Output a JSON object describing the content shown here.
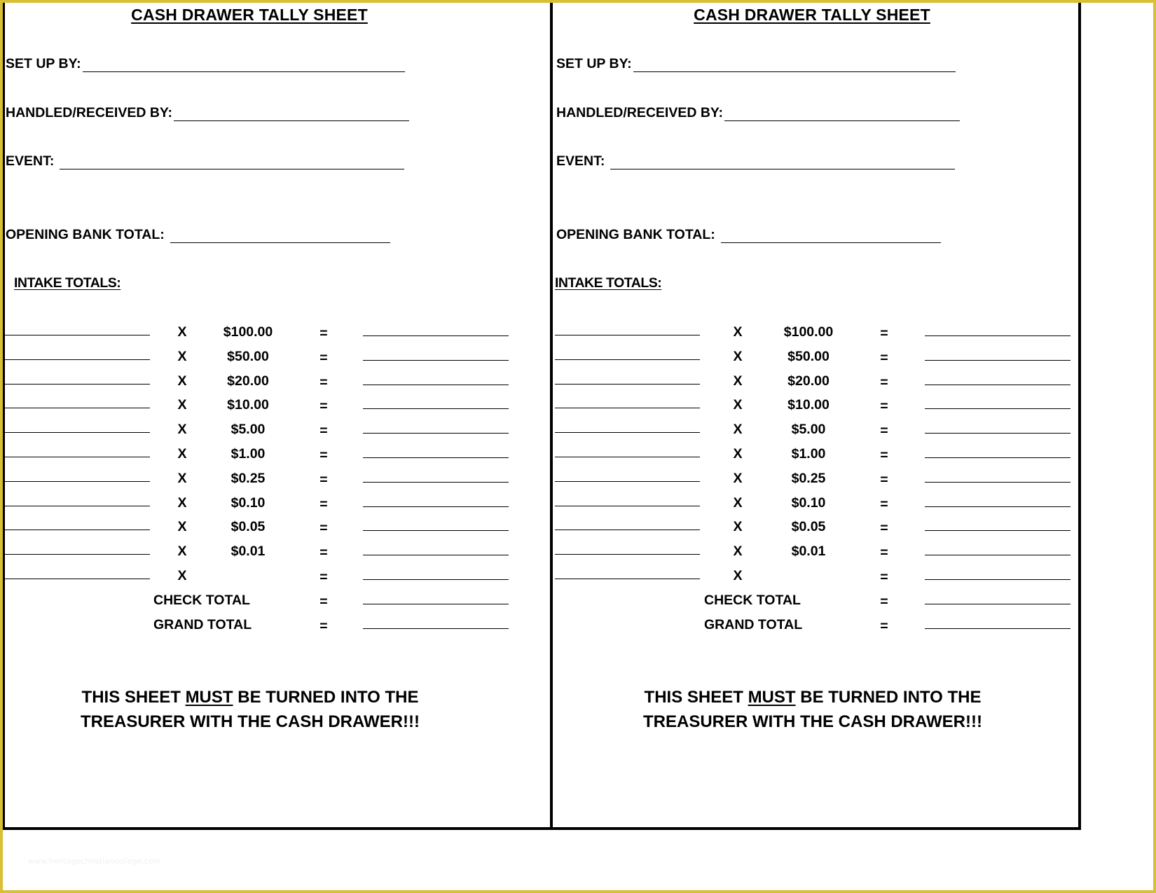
{
  "sheets": [
    {
      "title": "CASH DRAWER TALLY SHEET",
      "fields": {
        "set_up_by": "SET UP BY:",
        "handled_received_by": "HANDLED/RECEIVED BY:",
        "event": "EVENT:",
        "opening_bank_total": "OPENING BANK TOTAL:"
      },
      "intake_heading": "INTAKE TOTALS:",
      "multiply_symbol": "X",
      "equals_symbol": "=",
      "denominations": [
        "$100.00",
        "$50.00",
        "$20.00",
        "$10.00",
        "$5.00",
        "$1.00",
        "$0.25",
        "$0.10",
        "$0.05",
        "$0.01",
        ""
      ],
      "check_total_label": "CHECK TOTAL",
      "grand_total_label": "GRAND TOTAL",
      "notice": {
        "prefix": "THIS SHEET ",
        "emphasis": "MUST",
        "suffix": " BE TURNED INTO THE",
        "line2": "TREASURER WITH THE CASH DRAWER!!!"
      }
    },
    {
      "title": "CASH DRAWER TALLY SHEET",
      "fields": {
        "set_up_by": "SET UP BY:",
        "handled_received_by": "HANDLED/RECEIVED BY:",
        "event": "EVENT:",
        "opening_bank_total": "OPENING BANK TOTAL:"
      },
      "intake_heading": "INTAKE TOTALS:",
      "multiply_symbol": "X",
      "equals_symbol": "=",
      "denominations": [
        "$100.00",
        "$50.00",
        "$20.00",
        "$10.00",
        "$5.00",
        "$1.00",
        "$0.25",
        "$0.10",
        "$0.05",
        "$0.01",
        ""
      ],
      "check_total_label": "CHECK TOTAL",
      "grand_total_label": "GRAND TOTAL",
      "notice": {
        "prefix": "THIS SHEET ",
        "emphasis": "MUST",
        "suffix": " BE TURNED INTO THE",
        "line2": "TREASURER WITH THE CASH DRAWER!!!"
      }
    }
  ],
  "watermark": "www.heritagechristiancollege.com",
  "colors": {
    "frame_border": "#d8bf36",
    "ink": "#000000",
    "paper": "#ffffff"
  }
}
